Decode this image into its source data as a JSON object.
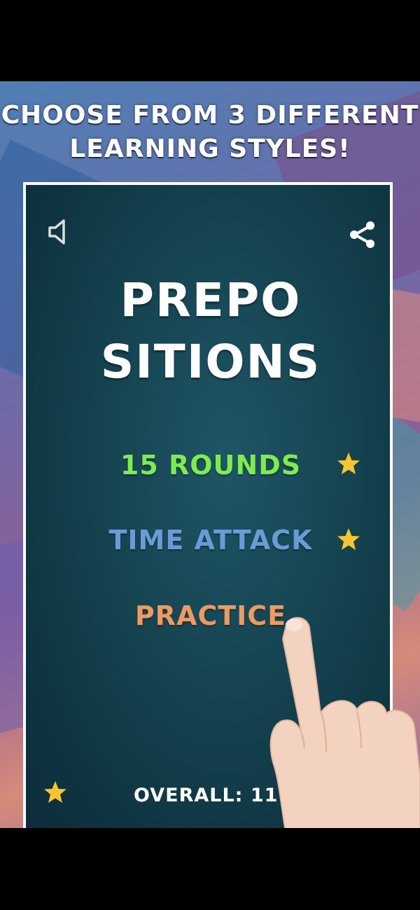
{
  "promo": {
    "headline_line1": "CHOOSE FROM 3 DIFFERENT",
    "headline_line2": "LEARNING STYLES!"
  },
  "game": {
    "title_line1": "PREPO",
    "title_line2": "SITIONS",
    "modes": [
      {
        "label": "15 ROUNDS",
        "color": "#7ded4d",
        "starred": true
      },
      {
        "label": "TIME ATTACK",
        "color": "#6b9bd6",
        "starred": true
      },
      {
        "label": "PRACTICE",
        "color": "#ee9a63",
        "starred": false
      }
    ],
    "overall_label": "OVERALL: 1179",
    "icons": [
      "speaker-icon",
      "share-icon",
      "star-icon"
    ],
    "star_color": "#f6c531"
  }
}
